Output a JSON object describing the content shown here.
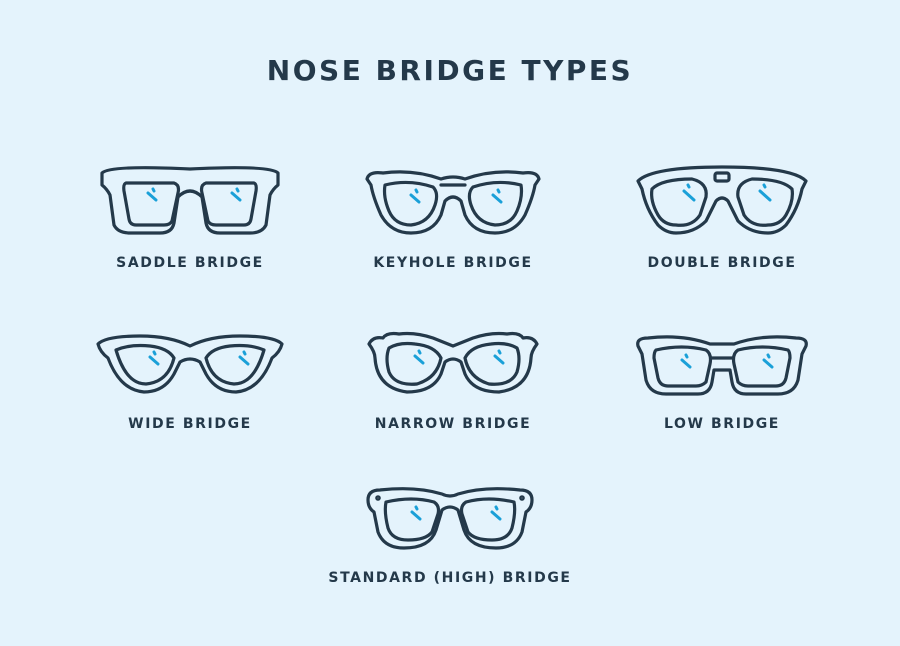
{
  "title": "NOSE BRIDGE TYPES",
  "colors": {
    "background": "#e4f3fc",
    "outline": "#24394a",
    "accent": "#1aa0d8"
  },
  "items": [
    {
      "label": "SADDLE BRIDGE",
      "icon": "saddle-bridge-glasses-icon"
    },
    {
      "label": "KEYHOLE BRIDGE",
      "icon": "keyhole-bridge-glasses-icon"
    },
    {
      "label": "DOUBLE BRIDGE",
      "icon": "double-bridge-glasses-icon"
    },
    {
      "label": "WIDE BRIDGE",
      "icon": "wide-bridge-glasses-icon"
    },
    {
      "label": "NARROW BRIDGE",
      "icon": "narrow-bridge-glasses-icon"
    },
    {
      "label": "LOW BRIDGE",
      "icon": "low-bridge-glasses-icon"
    },
    {
      "label": "STANDARD (HIGH) BRIDGE",
      "icon": "standard-high-bridge-glasses-icon"
    }
  ]
}
